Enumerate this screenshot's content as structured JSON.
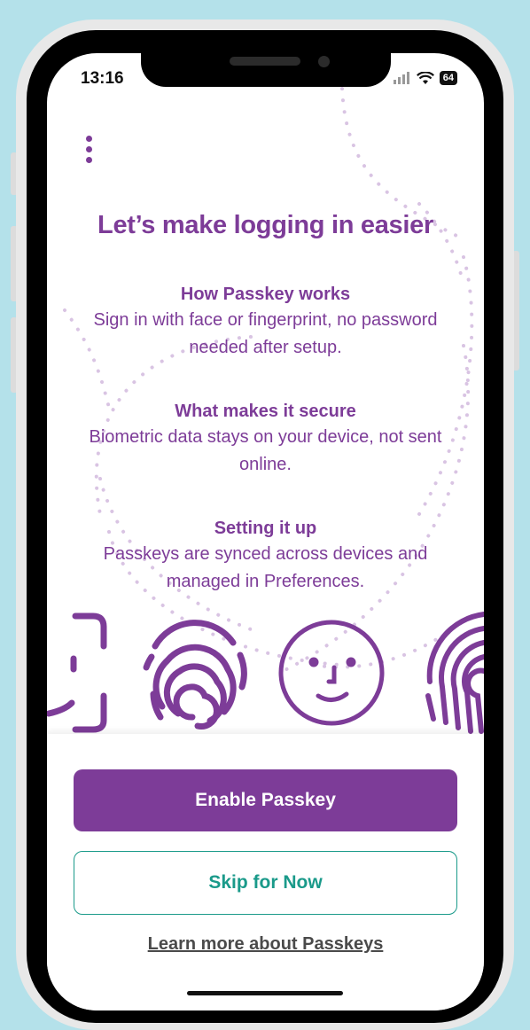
{
  "status_bar": {
    "time": "13:16",
    "battery": "64"
  },
  "main": {
    "title": "Let’s make logging in easier",
    "sections": [
      {
        "title": "How Passkey works",
        "body": "Sign in with face or fingerprint, no password needed after setup."
      },
      {
        "title": "What makes it secure",
        "body": "Biometric data stays on your device, not sent online."
      },
      {
        "title": "Setting it up",
        "body": "Passkeys are synced across devices and managed in Preferences."
      }
    ]
  },
  "icons": [
    "face-scan-icon",
    "fingerprint-icon",
    "face-icon",
    "fingerprint-icon"
  ],
  "actions": {
    "enable_label": "Enable Passkey",
    "skip_label": "Skip for Now",
    "learn_more_label": "Learn more about Passkeys"
  },
  "colors": {
    "brand_purple": "#7d3c98",
    "teal": "#1a9a8a",
    "background": "#b4e1ea"
  }
}
